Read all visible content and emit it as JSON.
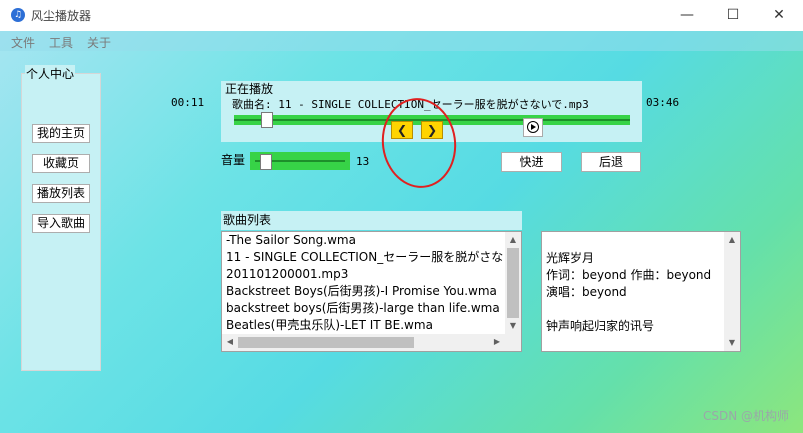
{
  "window": {
    "title": "风尘播放器",
    "icon": "music-note-icon",
    "controls": {
      "minimize": "—",
      "maximize": "☐",
      "close": "✕"
    }
  },
  "menu": {
    "items": [
      "文件",
      "工具",
      "关于"
    ]
  },
  "personal": {
    "label": "个人中心",
    "buttons": [
      "我的主页",
      "收藏页",
      "播放列表",
      "导入歌曲"
    ]
  },
  "player": {
    "label": "正在播放",
    "song_line": "歌曲名: 11 - SINGLE COLLECTION_セーラー服を脱がさないで.mp3",
    "elapsed": "00:11",
    "duration": "03:46",
    "progress_fraction": 0.05,
    "prev_glyph": "❮",
    "next_glyph": "❯",
    "play_icon": "play-icon"
  },
  "volume": {
    "label": "音量",
    "value": "13"
  },
  "buttons": {
    "forward": "快进",
    "back": "后退"
  },
  "songlist": {
    "label": "歌曲列表",
    "items": [
      "-The Sailor Song.wma",
      "11 - SINGLE COLLECTION_セーラー服を脱がさな",
      "201101200001.mp3",
      "Backstreet Boys(后街男孩)-I Promise You.wma",
      "backstreet boys(后街男孩)-large than life.wma",
      "Beatles(甲壳虫乐队)-LET IT BE.wma"
    ]
  },
  "lyrics": {
    "lines": [
      "光辉岁月",
      "作词：beyond 作曲：beyond",
      "演唱：beyond",
      "钟声响起归家的讯号"
    ]
  },
  "annotation_color": "#e02020",
  "accent_green": "#37d347",
  "watermark": "CSDN @机构师"
}
